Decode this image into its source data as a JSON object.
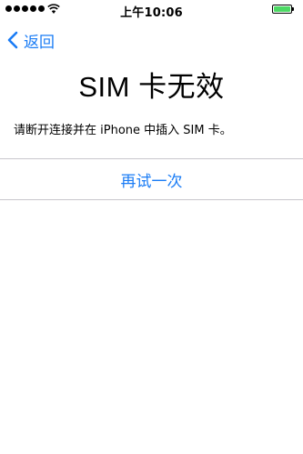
{
  "status_bar": {
    "signal_icon": "signal-dots-icon",
    "wifi_icon": "wifi-icon",
    "time": "上午10:06",
    "battery_icon": "battery-icon",
    "battery_level": 1.0,
    "battery_color": "#4cd964"
  },
  "nav": {
    "back_icon": "chevron-left-icon",
    "back_label": "返回"
  },
  "main": {
    "title": "SIM 卡无效",
    "message": "请断开连接并在 iPhone 中插入 SIM 卡。",
    "retry_label": "再试一次"
  },
  "colors": {
    "accent": "#1a7cf5",
    "divider": "#c8c7cc",
    "background": "#ffffff"
  }
}
